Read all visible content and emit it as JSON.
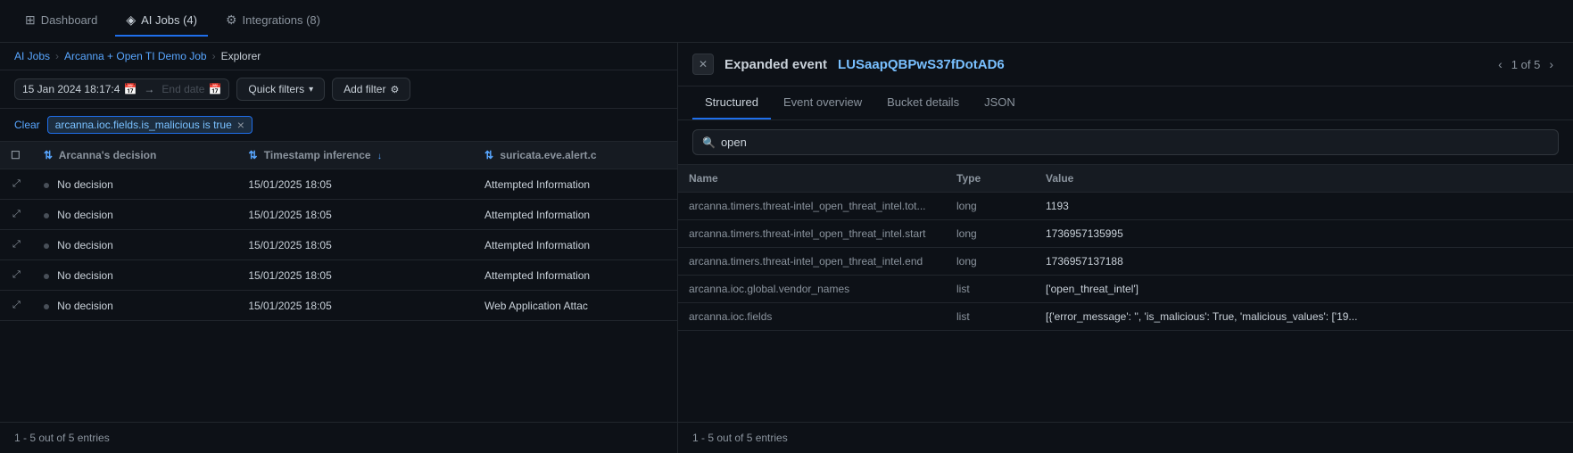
{
  "nav": {
    "items": [
      {
        "id": "dashboard",
        "label": "Dashboard",
        "icon": "⊞",
        "active": false
      },
      {
        "id": "ai-jobs",
        "label": "AI Jobs (4)",
        "icon": "◈",
        "active": true
      },
      {
        "id": "integrations",
        "label": "Integrations (8)",
        "icon": "⚙",
        "active": false
      }
    ]
  },
  "breadcrumb": {
    "items": [
      {
        "label": "AI Jobs",
        "link": true
      },
      {
        "label": "Arcanna + Open TI Demo Job",
        "link": true
      },
      {
        "label": "Explorer",
        "link": false
      }
    ]
  },
  "toolbar": {
    "start_date": "15 Jan 2024 18:17:4",
    "end_date_placeholder": "End date",
    "quick_filters_label": "Quick filters",
    "add_filter_label": "Add filter"
  },
  "filter_bar": {
    "clear_label": "Clear",
    "active_filter": "arcanna.ioc.fields.is_malicious is true"
  },
  "table": {
    "columns": [
      {
        "id": "expand",
        "label": ""
      },
      {
        "id": "decision",
        "label": "Arcanna's decision",
        "sortable": true
      },
      {
        "id": "timestamp",
        "label": "Timestamp inference",
        "sortable": true
      },
      {
        "id": "suricata",
        "label": "suricata.eve.alert.c",
        "sortable": false
      }
    ],
    "rows": [
      {
        "decision": "No decision",
        "timestamp": "15/01/2025 18:05",
        "suricata": "Attempted Information"
      },
      {
        "decision": "No decision",
        "timestamp": "15/01/2025 18:05",
        "suricata": "Attempted Information"
      },
      {
        "decision": "No decision",
        "timestamp": "15/01/2025 18:05",
        "suricata": "Attempted Information"
      },
      {
        "decision": "No decision",
        "timestamp": "15/01/2025 18:05",
        "suricata": "Attempted Information"
      },
      {
        "decision": "No decision",
        "timestamp": "15/01/2025 18:05",
        "suricata": "Web Application Attac"
      }
    ],
    "footer": "1 - 5 out of 5 entries"
  },
  "right_panel": {
    "title": "Expanded event",
    "event_id": "LUSaapQBPwS37fDotAD6",
    "pagination": "1 of 5",
    "tabs": [
      {
        "id": "structured",
        "label": "Structured",
        "active": true
      },
      {
        "id": "event-overview",
        "label": "Event overview",
        "active": false
      },
      {
        "id": "bucket-details",
        "label": "Bucket details",
        "active": false
      },
      {
        "id": "json",
        "label": "JSON",
        "active": false
      }
    ],
    "search_placeholder": "open",
    "detail_table": {
      "columns": [
        {
          "id": "name",
          "label": "Name"
        },
        {
          "id": "type",
          "label": "Type"
        },
        {
          "id": "value",
          "label": "Value"
        }
      ],
      "rows": [
        {
          "name": "arcanna.timers.threat-intel_open_threat_intel.tot...",
          "type": "long",
          "value": "1193"
        },
        {
          "name": "arcanna.timers.threat-intel_open_threat_intel.start",
          "type": "long",
          "value": "1736957135995"
        },
        {
          "name": "arcanna.timers.threat-intel_open_threat_intel.end",
          "type": "long",
          "value": "1736957137188"
        },
        {
          "name": "arcanna.ioc.global.vendor_names",
          "type": "list",
          "value": "['open_threat_intel']"
        },
        {
          "name": "arcanna.ioc.fields",
          "type": "list",
          "value": "[{'error_message': '', 'is_malicious': True, 'malicious_values': ['19..."
        }
      ],
      "footer": "1 - 5 out of 5 entries"
    }
  }
}
